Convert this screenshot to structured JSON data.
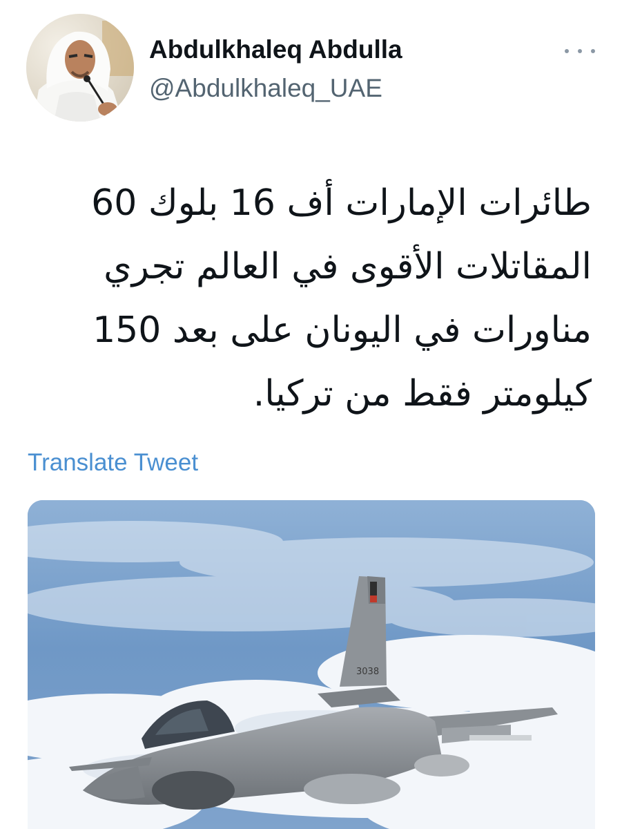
{
  "author": {
    "display_name": "Abdulkhaleq Abdulla",
    "handle": "@Abdulkhaleq_UAE",
    "avatar_icon": "profile-photo"
  },
  "tweet": {
    "text_lines": [
      "طائرات الإمارات أف 16 بلوك 60",
      "المقاتلات الأقوى في العالم تجري",
      "مناورات في اليونان على بعد 150",
      "كيلومتر فقط من تركيا."
    ],
    "translate_label": "Translate Tweet",
    "media_description_icon": "fighter-jet-photo",
    "jet_tail_number": "3038"
  },
  "colors": {
    "link": "#4a8fd1",
    "handle": "#536471",
    "text": "#0f1419",
    "more_dots": "#8b98a5"
  }
}
